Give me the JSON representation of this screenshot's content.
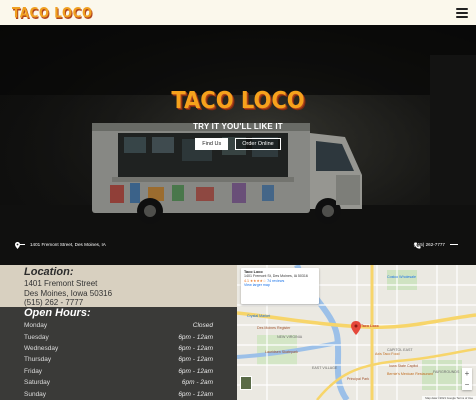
{
  "header": {
    "logo": "TACO LOCO",
    "menu_icon": "hamburger-menu-icon"
  },
  "hero": {
    "title": "TACO LOCO",
    "tagline": "TRY IT YOU'LL LIKE IT",
    "buttons": {
      "find_us": "Find Us",
      "order_online": "Order Online"
    },
    "address": "1401 Fremont Street, Des Moines, IA",
    "phone": "(515) 262-7777",
    "icons": {
      "address": "map-pin-icon",
      "phone": "phone-icon"
    }
  },
  "location": {
    "heading": "Location:",
    "street": "1401 Fremont Street",
    "city": "Des Moines, Iowa 50316",
    "phone": "(515) 262 - 7777"
  },
  "hours": {
    "heading": "Open Hours:",
    "days": [
      {
        "day": "Monday",
        "time": "Closed"
      },
      {
        "day": "Tuesday",
        "time": "6pm - 12am"
      },
      {
        "day": "Wednesday",
        "time": "6pm - 12am"
      },
      {
        "day": "Thursday",
        "time": "6pm - 12am"
      },
      {
        "day": "Friday",
        "time": "6pm - 12am"
      },
      {
        "day": "Saturday",
        "time": "6pm - 2am"
      },
      {
        "day": "Sunday",
        "time": "6pm - 12am"
      }
    ]
  },
  "map": {
    "card": {
      "place": "Taco Loco",
      "address": "1401 Fremont St, Des Moines, IA 50316",
      "rating": "4.1 ★★★★☆",
      "reviews": "74 reviews",
      "link": "View larger map"
    },
    "labels": {
      "pin_label": "Taco Loco",
      "neighborhood_1": "NEW VIRGINIA",
      "neighborhood_2": "EAST VILLAGE",
      "neighborhood_3": "CAPITOL EAST",
      "neighborhood_4": "FAIRGROUNDS",
      "poi_1": "Des Moines Register",
      "poi_2": "Lauridsen Skatepark",
      "poi_3": "Principal Park",
      "poi_4": "Iowa State Capitol",
      "poi_5": "Axis Taco Food",
      "poi_6": "Bernie's Mexican Restaurant",
      "poi_7": "Costco Wholesale",
      "poi_8": "Crystal Market"
    },
    "zoom_in": "+",
    "zoom_out": "−",
    "attribution": "Map data ©2021 Google  Terms of Use"
  },
  "colors": {
    "brand_orange": "#f6a21c",
    "brand_red": "#b2451c",
    "header_bg": "#fbf8ec",
    "location_bg": "#d8d0c0",
    "hours_bg": "#3a3a38"
  }
}
